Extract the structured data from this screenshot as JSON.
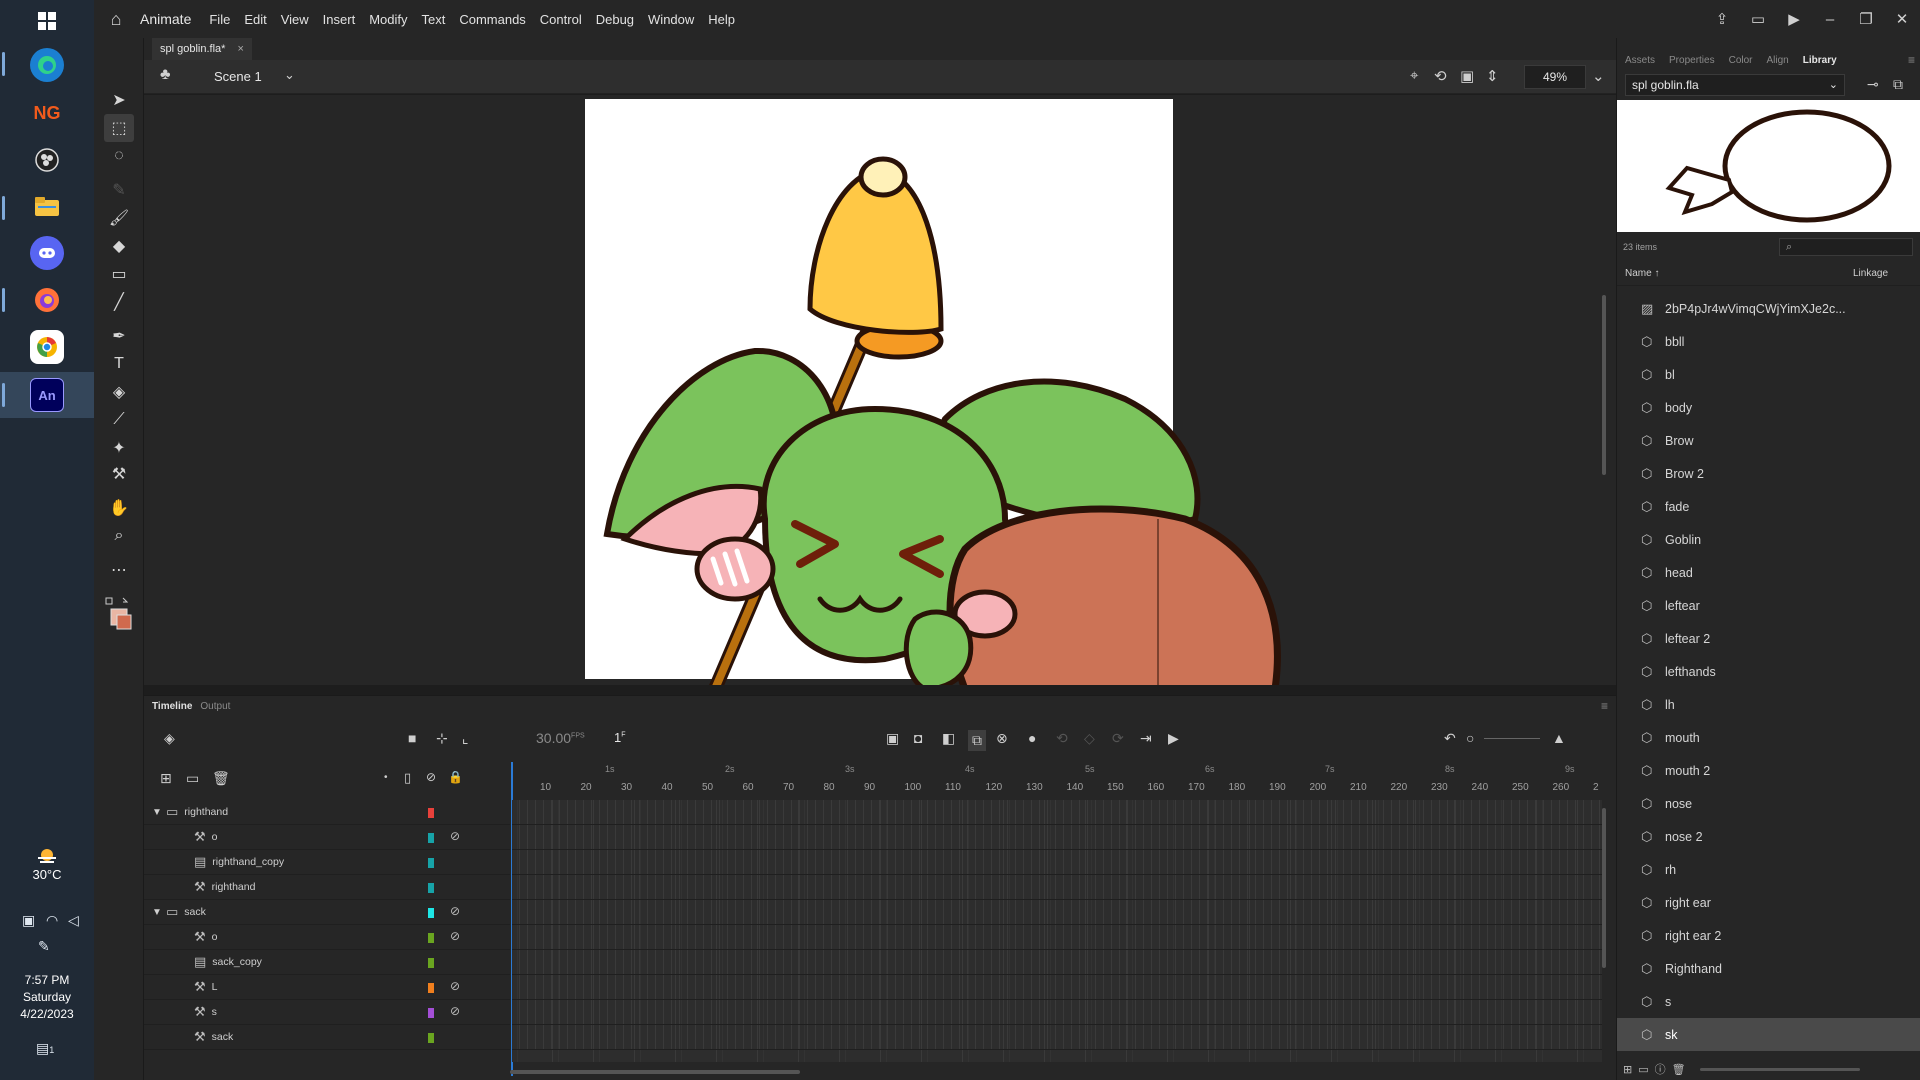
{
  "taskbar": {
    "icons": [
      "windows-start-icon",
      "edge-browser-icon",
      "newgrounds-icon",
      "obs-icon",
      "file-explorer-icon",
      "discord-icon",
      "firefox-icon",
      "chrome-canary-icon",
      "animate-icon"
    ],
    "ng_label": "NG",
    "an_label": "An",
    "weather_temp": "30°C",
    "time": "7:57 PM",
    "day": "Saturday",
    "date": "4/22/2023",
    "notification_count": "1"
  },
  "menubar": {
    "app_name": "Animate",
    "menus": [
      "File",
      "Edit",
      "View",
      "Insert",
      "Modify",
      "Text",
      "Commands",
      "Control",
      "Debug",
      "Window",
      "Help"
    ]
  },
  "document": {
    "tab_name": "spl goblin.fla*",
    "scene": "Scene 1",
    "zoom": "49%"
  },
  "timeline": {
    "tabs": [
      "Timeline",
      "Output"
    ],
    "fps": "30.00",
    "fps_unit": "FPS",
    "current_frame": "1",
    "frame_unit": "F",
    "ruler_frames": [
      "10",
      "20",
      "30",
      "40",
      "50",
      "60",
      "70",
      "80",
      "90",
      "100",
      "110",
      "120",
      "130",
      "140",
      "150",
      "160",
      "170",
      "180",
      "190",
      "200",
      "210",
      "220",
      "230",
      "240",
      "250",
      "260",
      "2"
    ],
    "ruler_seconds": [
      "1s",
      "2s",
      "3s",
      "4s",
      "5s",
      "6s",
      "7s",
      "8s",
      "9s"
    ],
    "layers": [
      {
        "name": "righthand",
        "type": "folder",
        "color": "#e8413b",
        "hidden": false
      },
      {
        "name": "o",
        "type": "bone",
        "color": "#17a3a8",
        "hidden": true
      },
      {
        "name": "righthand_copy",
        "type": "layer",
        "color": "#17a3a8",
        "hidden": false
      },
      {
        "name": "righthand",
        "type": "bone",
        "color": "#17a3a8",
        "hidden": false
      },
      {
        "name": "sack",
        "type": "folder",
        "color": "#1ee6e6",
        "hidden": true
      },
      {
        "name": "o",
        "type": "bone",
        "color": "#6aa520",
        "hidden": true
      },
      {
        "name": "sack_copy",
        "type": "layer",
        "color": "#6aa520",
        "hidden": false
      },
      {
        "name": "L",
        "type": "bone",
        "color": "#f07f1e",
        "hidden": true
      },
      {
        "name": "s",
        "type": "bone",
        "color": "#a44fd6",
        "hidden": true
      },
      {
        "name": "sack",
        "type": "bone",
        "color": "#6aa520",
        "hidden": false
      }
    ]
  },
  "library": {
    "tabs": [
      "Assets",
      "Properties",
      "Color",
      "Align",
      "Library"
    ],
    "selected_file": "spl goblin.fla",
    "item_count": "23 items",
    "col_name": "Name",
    "col_linkage": "Linkage",
    "items": [
      {
        "name": "2bP4pJr4wVimqCWjYimXJe2c...",
        "type": "bitmap"
      },
      {
        "name": "bbll",
        "type": "symbol"
      },
      {
        "name": "bl",
        "type": "symbol"
      },
      {
        "name": "body",
        "type": "symbol"
      },
      {
        "name": "Brow",
        "type": "symbol"
      },
      {
        "name": "Brow 2",
        "type": "symbol"
      },
      {
        "name": "fade",
        "type": "symbol"
      },
      {
        "name": "Goblin",
        "type": "symbol"
      },
      {
        "name": "head",
        "type": "symbol"
      },
      {
        "name": "leftear",
        "type": "symbol"
      },
      {
        "name": "leftear 2",
        "type": "symbol"
      },
      {
        "name": "lefthands",
        "type": "symbol"
      },
      {
        "name": "lh",
        "type": "symbol"
      },
      {
        "name": "mouth",
        "type": "symbol"
      },
      {
        "name": "mouth 2",
        "type": "symbol"
      },
      {
        "name": "nose",
        "type": "symbol"
      },
      {
        "name": "nose 2",
        "type": "symbol"
      },
      {
        "name": "rh",
        "type": "symbol"
      },
      {
        "name": "right ear",
        "type": "symbol"
      },
      {
        "name": "right ear 2",
        "type": "symbol"
      },
      {
        "name": "Righthand",
        "type": "symbol"
      },
      {
        "name": "s",
        "type": "symbol"
      },
      {
        "name": "sk",
        "type": "symbol",
        "selected": true
      }
    ]
  },
  "colors": {
    "accent": "#2b7bd6",
    "goblin_green": "#7bc35c",
    "sack_brown": "#cc7356",
    "bell_yellow": "#ffd04a",
    "outline": "#2a1208"
  }
}
